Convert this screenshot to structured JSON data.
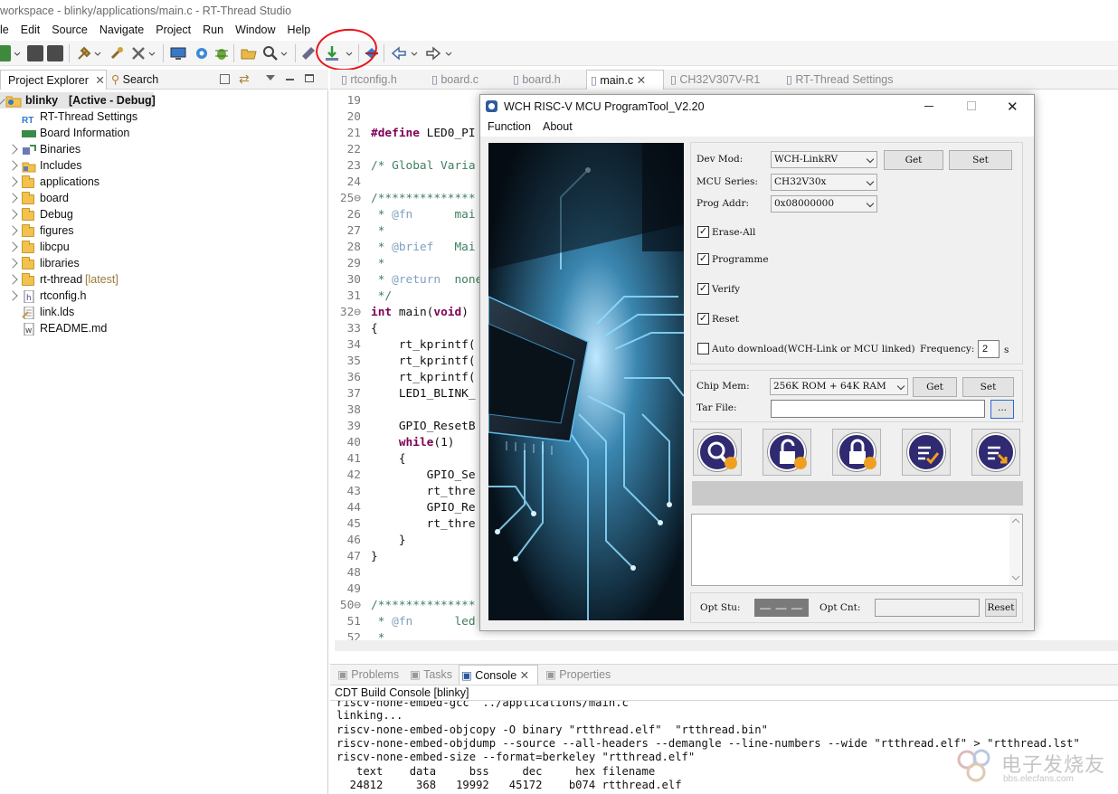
{
  "window": {
    "title": "workspace - blinky/applications/main.c - RT-Thread Studio"
  },
  "menubar": [
    "le",
    "Edit",
    "Source",
    "Navigate",
    "Project",
    "Run",
    "Window",
    "Help"
  ],
  "left_views": {
    "tabs": [
      {
        "label": "Project Explorer"
      },
      {
        "label": "Search"
      }
    ]
  },
  "tree": {
    "root": {
      "name": "blinky",
      "status": "[Active - Debug]"
    },
    "items": [
      {
        "label": "RT-Thread Settings",
        "icon": "rt-settings-icon",
        "expandable": false
      },
      {
        "label": "Board Information",
        "icon": "board-info-icon",
        "expandable": false
      },
      {
        "label": "Binaries",
        "icon": "binaries-icon",
        "expandable": true
      },
      {
        "label": "Includes",
        "icon": "includes-icon",
        "expandable": true
      },
      {
        "label": "applications",
        "icon": "folder-icon",
        "expandable": true
      },
      {
        "label": "board",
        "icon": "folder-icon",
        "expandable": true
      },
      {
        "label": "Debug",
        "icon": "folder-icon",
        "expandable": true
      },
      {
        "label": "figures",
        "icon": "folder-icon",
        "expandable": true
      },
      {
        "label": "libcpu",
        "icon": "folder-icon",
        "expandable": true
      },
      {
        "label": "libraries",
        "icon": "folder-icon",
        "expandable": true
      },
      {
        "label": "rt-thread",
        "suffix": "[latest]",
        "icon": "folder-icon",
        "expandable": true
      },
      {
        "label": "rtconfig.h",
        "icon": "header-file-icon",
        "expandable": true
      },
      {
        "label": "link.lds",
        "icon": "text-file-icon",
        "expandable": false
      },
      {
        "label": "README.md",
        "icon": "markdown-file-icon",
        "expandable": false
      }
    ]
  },
  "editor_tabs": [
    {
      "label": "rtconfig.h"
    },
    {
      "label": "board.c"
    },
    {
      "label": "board.h"
    },
    {
      "label": "main.c",
      "active": true
    },
    {
      "label": "CH32V307V-R1"
    },
    {
      "label": "RT-Thread Settings"
    }
  ],
  "code_lines": [
    {
      "n": "19",
      "t": ""
    },
    {
      "n": "20",
      "t": ""
    },
    {
      "n": "21",
      "t": "#define LED0_PI"
    },
    {
      "n": "22",
      "t": ""
    },
    {
      "n": "23",
      "t": "/* Global Varia"
    },
    {
      "n": "24",
      "t": ""
    },
    {
      "n": "25⊖",
      "t": "/**************"
    },
    {
      "n": "26",
      "t": " * @fn      mai"
    },
    {
      "n": "27",
      "t": " *"
    },
    {
      "n": "28",
      "t": " * @brief   Mai"
    },
    {
      "n": "29",
      "t": " *"
    },
    {
      "n": "30",
      "t": " * @return  none"
    },
    {
      "n": "31",
      "t": " */"
    },
    {
      "n": "32⊖",
      "t": "int main(void)"
    },
    {
      "n": "33",
      "t": "{"
    },
    {
      "n": "34",
      "t": "    rt_kprintf("
    },
    {
      "n": "35",
      "t": "    rt_kprintf("
    },
    {
      "n": "36",
      "t": "    rt_kprintf("
    },
    {
      "n": "37",
      "t": "    LED1_BLINK_"
    },
    {
      "n": "38",
      "t": ""
    },
    {
      "n": "39",
      "t": "    GPIO_ResetB"
    },
    {
      "n": "40",
      "t": "    while(1)"
    },
    {
      "n": "41",
      "t": "    {"
    },
    {
      "n": "42",
      "t": "        GPIO_Se"
    },
    {
      "n": "43",
      "t": "        rt_thre"
    },
    {
      "n": "44",
      "t": "        GPIO_Re"
    },
    {
      "n": "45",
      "t": "        rt_thre"
    },
    {
      "n": "46",
      "t": "    }"
    },
    {
      "n": "47",
      "t": "}"
    },
    {
      "n": "48",
      "t": ""
    },
    {
      "n": "49",
      "t": ""
    },
    {
      "n": "50⊖",
      "t": "/**************"
    },
    {
      "n": "51",
      "t": " * @fn      led"
    },
    {
      "n": "52",
      "t": " *"
    }
  ],
  "bottom_tabs": [
    {
      "label": "Problems"
    },
    {
      "label": "Tasks"
    },
    {
      "label": "Console"
    },
    {
      "label": "Properties"
    }
  ],
  "console": {
    "title": "CDT Build Console [blinky]",
    "lines": [
      "riscv-none-embed-gcc  ../applications/main.c",
      "linking...",
      "riscv-none-embed-objcopy -O binary \"rtthread.elf\"  \"rtthread.bin\"",
      "riscv-none-embed-objdump --source --all-headers --demangle --line-numbers --wide \"rtthread.elf\" > \"rtthread.lst\"",
      "riscv-none-embed-size --format=berkeley \"rtthread.elf\"",
      "   text\t   data\t    bss\t    dec\t    hex\tfilename",
      "  24812\t    368\t  19992\t  45172\t   b074\trtthread.elf"
    ]
  },
  "tool": {
    "title": "WCH RISC-V MCU ProgramTool_V2.20",
    "menu": [
      "Function",
      "About"
    ],
    "dev_mod": {
      "label": "Dev Mod:",
      "value": "WCH-LinkRV"
    },
    "mcu_series": {
      "label": "MCU Series:",
      "value": "CH32V30x"
    },
    "prog_addr": {
      "label": "Prog Addr:",
      "value": "0x08000000"
    },
    "get_label": "Get",
    "set_label": "Set",
    "checks": [
      {
        "label": "Erase-All",
        "checked": true
      },
      {
        "label": "Programme",
        "checked": true
      },
      {
        "label": "Verify",
        "checked": true
      },
      {
        "label": "Reset",
        "checked": true
      }
    ],
    "auto_download": {
      "label": "Auto download(WCH-Link or MCU linked)",
      "checked": false
    },
    "frequency": {
      "label": "Frequency:",
      "value": "2",
      "unit": "s"
    },
    "chip_mem": {
      "label": "Chip Mem:",
      "value": "256K ROM +  64K RAM"
    },
    "tar_file": {
      "label": "Tar File:",
      "value": "",
      "browse": "..."
    },
    "opt_stu": {
      "label": "Opt Stu:",
      "value": "— — —"
    },
    "opt_cnt": {
      "label": "Opt Cnt:",
      "value": ""
    },
    "reset_label": "Reset"
  },
  "watermark": {
    "text": "电子发烧友",
    "domain": "bbs.elecfans.com"
  },
  "colors": {
    "accent": "#2f2a72",
    "annotation": "#e8151a",
    "keyword": "#7f0055",
    "comment": "#3f7f5f"
  }
}
